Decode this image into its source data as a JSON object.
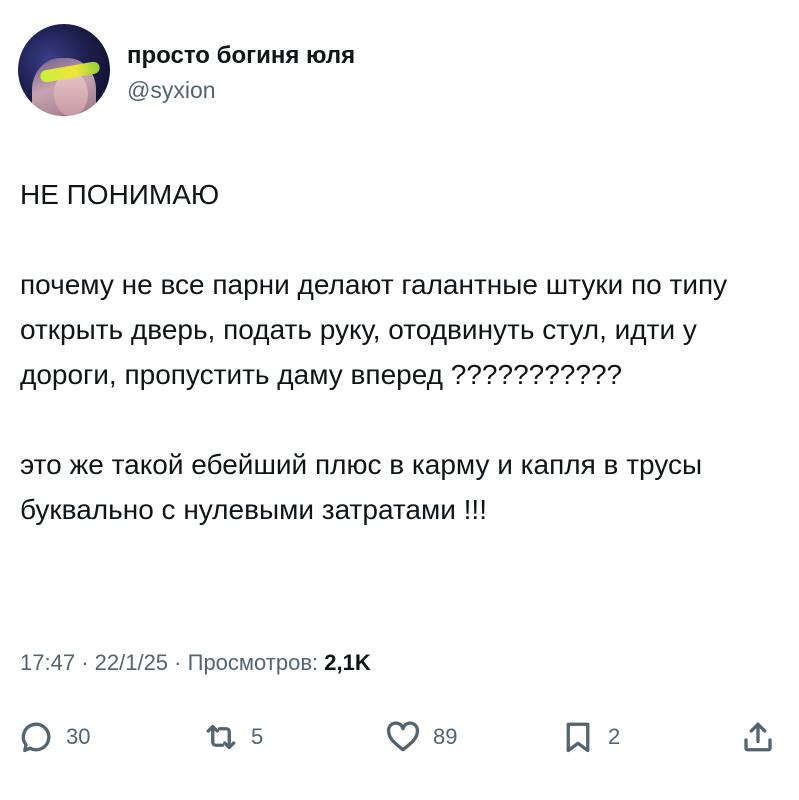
{
  "author": {
    "display_name": "просто богиня юля",
    "handle": "@syxion",
    "avatar_icon": "profile-photo"
  },
  "tweet": {
    "paragraphs": [
      "НЕ ПОНИМАЮ",
      "почему не все парни делают галантные штуки по типу открыть дверь, подать руку, отодвинуть стул, идти у дороги, пропустить даму вперед ???????????",
      "это же такой ебейший плюс в карму и капля в трусы буквально с нулевыми затратами !!!"
    ]
  },
  "meta": {
    "time": "17:47",
    "separator": "·",
    "date": "22/1/25",
    "views_label": "Просмотров:",
    "views_count": "2,1K"
  },
  "actions": {
    "replies": {
      "icon": "reply-icon",
      "count": "30"
    },
    "reposts": {
      "icon": "repost-icon",
      "count": "5"
    },
    "likes": {
      "icon": "like-icon",
      "count": "89"
    },
    "bookmarks": {
      "icon": "bookmark-icon",
      "count": "2"
    },
    "share": {
      "icon": "share-icon"
    }
  },
  "colors": {
    "text_primary": "#0f1419",
    "text_secondary": "#536471",
    "background": "#ffffff"
  }
}
